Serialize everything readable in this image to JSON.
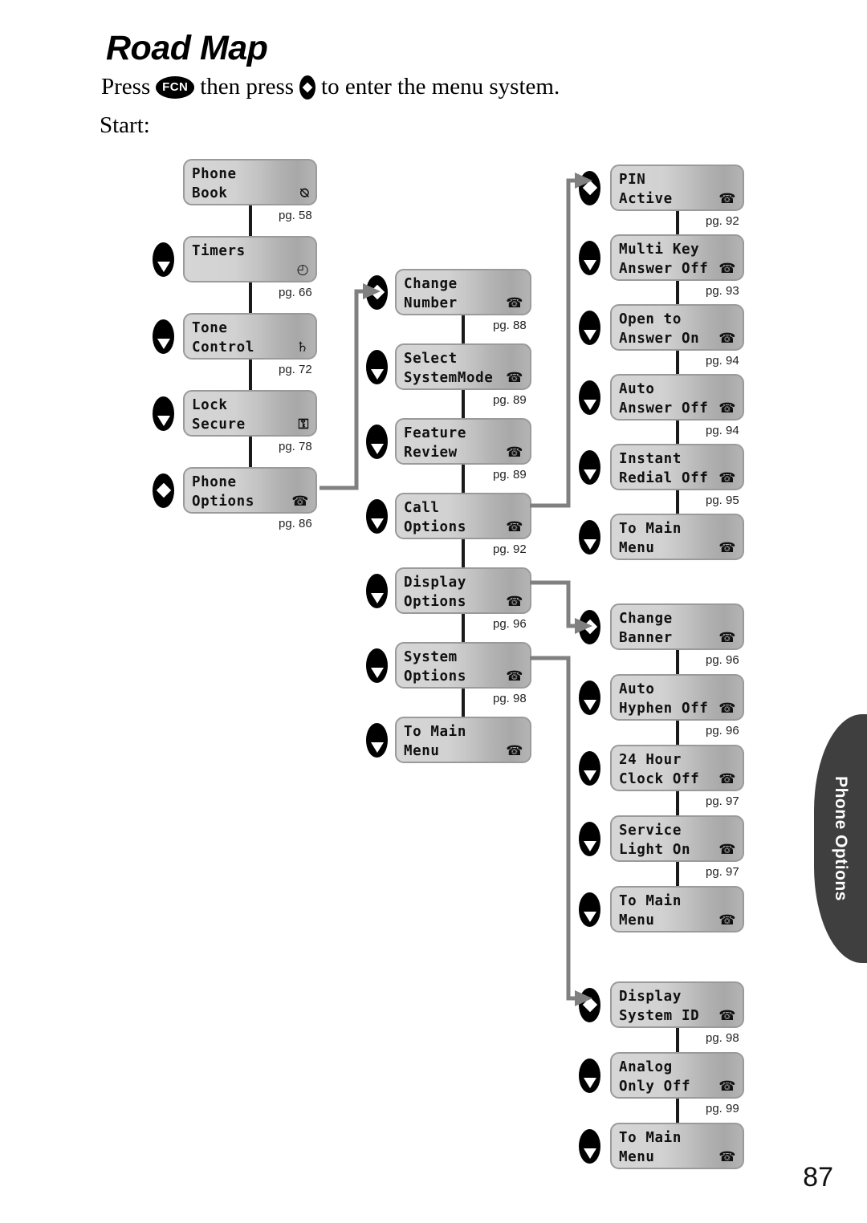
{
  "header": {
    "title": "Road Map",
    "instruction_before": "Press",
    "fcn_key_label": "FCN",
    "instruction_middle": "then press",
    "instruction_after": "to enter the menu system.",
    "start_label": "Start:"
  },
  "side_tab": {
    "label": "Phone Options"
  },
  "page_number": "87",
  "icons": {
    "book": "⍉",
    "clock": "◴",
    "bell": "♄",
    "lock": "⚿",
    "phone": "☎"
  },
  "columns": [
    {
      "id": "main-menu",
      "items": [
        {
          "line1": "Phone",
          "line2": "Book",
          "icon": "book",
          "icon_name": "book-icon",
          "page": "pg. 58",
          "key": "none"
        },
        {
          "line1": "Timers",
          "line2": "",
          "icon": "clock",
          "icon_name": "clock-icon",
          "page": "pg. 66",
          "key": "down"
        },
        {
          "line1": "Tone",
          "line2": "Control",
          "icon": "bell",
          "icon_name": "bell-icon",
          "page": "pg. 72",
          "key": "down"
        },
        {
          "line1": "Lock",
          "line2": "Secure",
          "icon": "lock",
          "icon_name": "lock-icon",
          "page": "pg. 78",
          "key": "down"
        },
        {
          "line1": "Phone",
          "line2": "Options",
          "icon": "phone",
          "icon_name": "phone-icon",
          "page": "pg. 86",
          "key": "select"
        }
      ]
    },
    {
      "id": "phone-options",
      "items": [
        {
          "line1": "Change",
          "line2": "Number",
          "icon": "phone",
          "icon_name": "phone-icon",
          "page": "pg. 88",
          "key": "select"
        },
        {
          "line1": "Select",
          "line2": "SystemMode",
          "icon": "phone",
          "icon_name": "phone-icon",
          "page": "pg. 89",
          "key": "down"
        },
        {
          "line1": "Feature",
          "line2": "Review",
          "icon": "phone",
          "icon_name": "phone-icon",
          "page": "pg. 89",
          "key": "down"
        },
        {
          "line1": "Call",
          "line2": "Options",
          "icon": "phone",
          "icon_name": "phone-icon",
          "page": "pg. 92",
          "key": "down"
        },
        {
          "line1": "Display",
          "line2": "Options",
          "icon": "phone",
          "icon_name": "phone-icon",
          "page": "pg. 96",
          "key": "down"
        },
        {
          "line1": "System",
          "line2": "Options",
          "icon": "phone",
          "icon_name": "phone-icon",
          "page": "pg. 98",
          "key": "down"
        },
        {
          "line1": "To Main",
          "line2": "Menu",
          "icon": "phone",
          "icon_name": "phone-icon",
          "page": "",
          "key": "down"
        }
      ]
    },
    {
      "id": "call-options",
      "items": [
        {
          "line1": "PIN",
          "line2": "Active",
          "icon": "phone",
          "icon_name": "phone-icon",
          "page": "pg. 92",
          "key": "select"
        },
        {
          "line1": "Multi Key",
          "line2": "Answer Off",
          "icon": "phone",
          "icon_name": "phone-icon",
          "page": "pg. 93",
          "key": "down"
        },
        {
          "line1": "Open to",
          "line2": "Answer On",
          "icon": "phone",
          "icon_name": "phone-icon",
          "page": "pg. 94",
          "key": "down"
        },
        {
          "line1": "Auto",
          "line2": "Answer Off",
          "icon": "phone",
          "icon_name": "phone-icon",
          "page": "pg. 94",
          "key": "down"
        },
        {
          "line1": "Instant",
          "line2": "Redial Off",
          "icon": "phone",
          "icon_name": "phone-icon",
          "page": "pg. 95",
          "key": "down"
        },
        {
          "line1": "To Main",
          "line2": "Menu",
          "icon": "phone",
          "icon_name": "phone-icon",
          "page": "",
          "key": "down"
        }
      ]
    },
    {
      "id": "display-options",
      "items": [
        {
          "line1": "Change",
          "line2": "Banner",
          "icon": "phone",
          "icon_name": "phone-icon",
          "page": "pg. 96",
          "key": "select"
        },
        {
          "line1": "Auto",
          "line2": "Hyphen Off",
          "icon": "phone",
          "icon_name": "phone-icon",
          "page": "pg. 96",
          "key": "down"
        },
        {
          "line1": "24 Hour",
          "line2": "Clock Off",
          "icon": "phone",
          "icon_name": "phone-icon",
          "page": "pg. 97",
          "key": "down"
        },
        {
          "line1": "Service",
          "line2": "Light On",
          "icon": "phone",
          "icon_name": "phone-icon",
          "page": "pg. 97",
          "key": "down"
        },
        {
          "line1": "To Main",
          "line2": "Menu",
          "icon": "phone",
          "icon_name": "phone-icon",
          "page": "",
          "key": "down"
        }
      ]
    },
    {
      "id": "system-options",
      "items": [
        {
          "line1": "Display",
          "line2": "System ID",
          "icon": "phone",
          "icon_name": "phone-icon",
          "page": "pg. 98",
          "key": "select"
        },
        {
          "line1": "Analog",
          "line2": "Only Off",
          "icon": "phone",
          "icon_name": "phone-icon",
          "page": "pg. 99",
          "key": "down"
        },
        {
          "line1": "To Main",
          "line2": "Menu",
          "icon": "phone",
          "icon_name": "phone-icon",
          "page": "",
          "key": "down"
        }
      ]
    }
  ]
}
